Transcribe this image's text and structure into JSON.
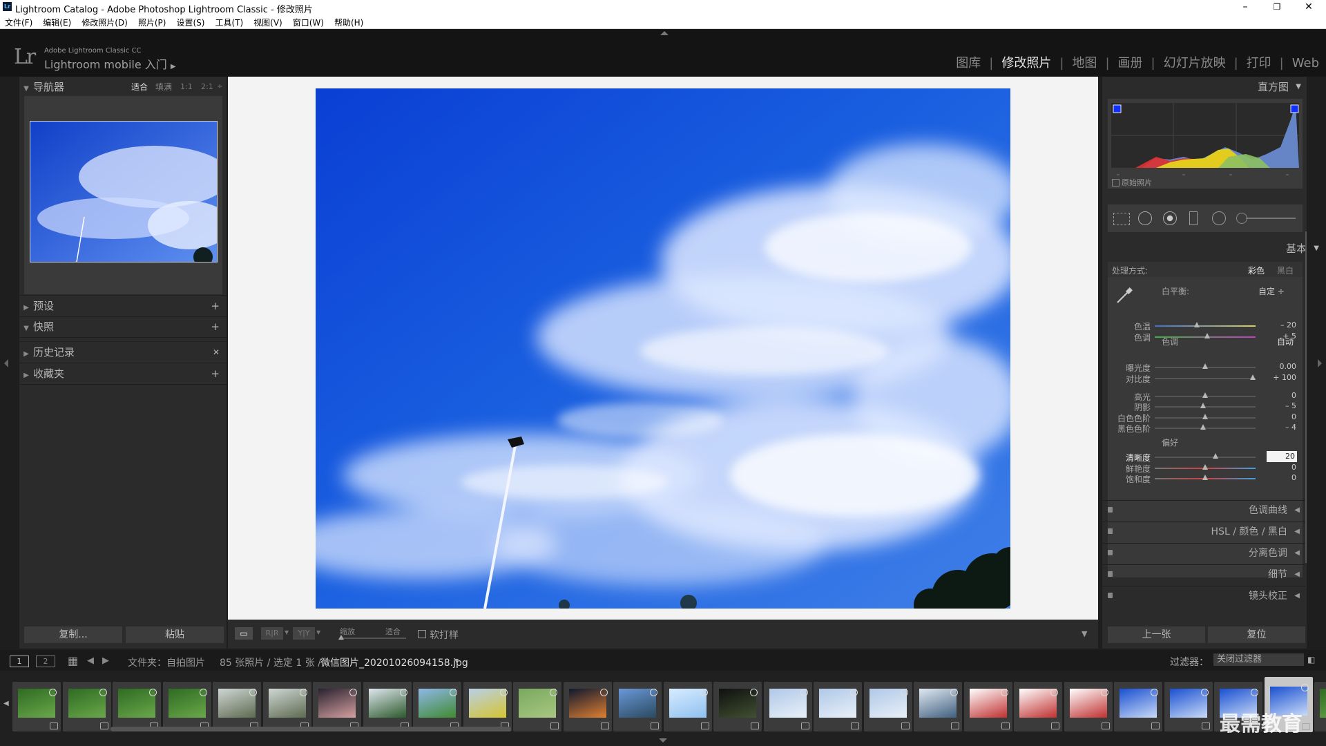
{
  "titlebar": {
    "title": "Lightroom Catalog - Adobe Photoshop Lightroom Classic - 修改照片",
    "logo": "Lr",
    "minimize": "–",
    "maximize": "❐",
    "close": "✕"
  },
  "menu": [
    "文件(F)",
    "编辑(E)",
    "修改照片(D)",
    "照片(P)",
    "设置(S)",
    "工具(T)",
    "视图(V)",
    "窗口(W)",
    "帮助(H)"
  ],
  "identity": {
    "logo": "Lr",
    "product": "Adobe Lightroom Classic CC",
    "mobile": "Lightroom mobile 入门",
    "arrow": "▶"
  },
  "modules": {
    "items": [
      "图库",
      "修改照片",
      "地图",
      "画册",
      "幻灯片放映",
      "打印",
      "Web"
    ],
    "active": "修改照片",
    "separator": "|"
  },
  "left": {
    "navigator": {
      "title": "导航器",
      "options": [
        "适合",
        "填满",
        "1:1",
        "2:1"
      ],
      "stepper": "÷"
    },
    "sections": [
      {
        "title": "预设",
        "action": "+"
      },
      {
        "title": "快照",
        "action": "+"
      },
      {
        "title": "历史记录",
        "action": "✕"
      },
      {
        "title": "收藏夹",
        "action": "+"
      }
    ],
    "copy_button": "复制...",
    "paste_button": "粘贴"
  },
  "toolbar": {
    "view_buttons": [
      "▭",
      "R|R",
      "Y|Y"
    ],
    "zoom_label": "缩放",
    "zoom_value": "适合",
    "softproof": "软打样",
    "dropdown": "▼"
  },
  "right": {
    "histogram_title": "直方图",
    "original_photo": "原始照片",
    "basic_title": "基本",
    "treatment_label": "处理方式:",
    "treatment_color": "彩色",
    "treatment_bw": "黑白",
    "wb_label": "白平衡:",
    "wb_value": "自定 ÷",
    "tone_label": "色调",
    "tone_auto": "自动",
    "presence_label": "偏好",
    "sliders": [
      {
        "label": "色温",
        "value": "– 20",
        "pos": 0.42,
        "grad": "temp"
      },
      {
        "label": "色调",
        "value": "+ 5",
        "pos": 0.52,
        "grad": "tint"
      },
      {
        "label": "曝光度",
        "value": "0.00",
        "pos": 0.5,
        "grad": "none"
      },
      {
        "label": "对比度",
        "value": "+ 100",
        "pos": 0.97,
        "grad": "none"
      },
      {
        "label": "高光",
        "value": "0",
        "pos": 0.5,
        "grad": "none"
      },
      {
        "label": "阴影",
        "value": "– 5",
        "pos": 0.48,
        "grad": "none"
      },
      {
        "label": "白色色阶",
        "value": "0",
        "pos": 0.5,
        "grad": "none"
      },
      {
        "label": "黑色色阶",
        "value": "– 4",
        "pos": 0.48,
        "grad": "none"
      },
      {
        "label": "清晰度",
        "value": "20",
        "pos": 0.6,
        "grad": "none",
        "editing": true
      },
      {
        "label": "鲜艳度",
        "value": "0",
        "pos": 0.5,
        "grad": "sat"
      },
      {
        "label": "饱和度",
        "value": "0",
        "pos": 0.5,
        "grad": "sat"
      }
    ],
    "collapsed_panels": [
      "色调曲线",
      "HSL / 颜色 / 黑白",
      "分离色调",
      "细节",
      "镜头校正"
    ],
    "prev_button": "上一张",
    "reset_button": "复位"
  },
  "filmbar": {
    "screen1": "1",
    "screen2": "2",
    "grid_icon": "▦",
    "back": "◀",
    "forward": "▶",
    "path": "文件夹：自拍图片",
    "count": "85 张照片 / 选定 1 张 /",
    "filename": "微信图片_20201026094158.jpg",
    "filename_arrow": "▾",
    "filter_label": "过滤器：",
    "filter_value": "关闭过滤器",
    "lock_icon": "◧"
  },
  "filmstrip": {
    "thumbs": [
      {
        "kind": "plant"
      },
      {
        "kind": "plant"
      },
      {
        "kind": "plant"
      },
      {
        "kind": "plant"
      },
      {
        "kind": "road"
      },
      {
        "kind": "road"
      },
      {
        "kind": "sunset"
      },
      {
        "kind": "tree"
      },
      {
        "kind": "field"
      },
      {
        "kind": "yellow"
      },
      {
        "kind": "leaf"
      },
      {
        "kind": "dusk"
      },
      {
        "kind": "lake"
      },
      {
        "kind": "sky-light"
      },
      {
        "kind": "night"
      },
      {
        "kind": "sky-pale"
      },
      {
        "kind": "sky-pale"
      },
      {
        "kind": "sky-pale"
      },
      {
        "kind": "lake2"
      },
      {
        "kind": "flower"
      },
      {
        "kind": "flower"
      },
      {
        "kind": "flower"
      },
      {
        "kind": "sky-blue"
      },
      {
        "kind": "sky-blue"
      },
      {
        "kind": "sky-blue"
      },
      {
        "kind": "sky-blue",
        "selected": true
      },
      {
        "kind": "plant"
      }
    ],
    "watermark": "最需教育"
  },
  "colors": {
    "panel": "#2b2b2b",
    "accent": "#e6e6e6",
    "sky": "#1a5fe0"
  }
}
